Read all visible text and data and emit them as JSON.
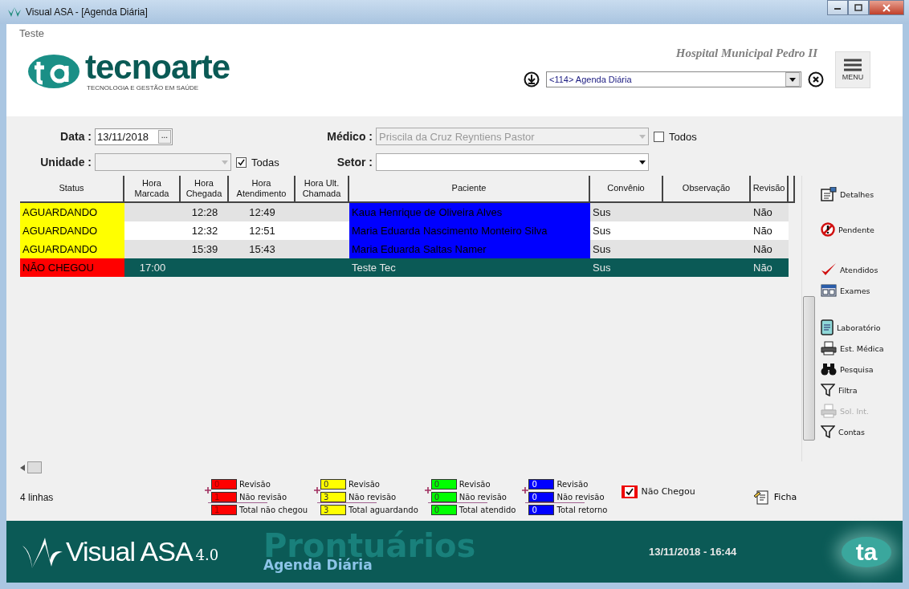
{
  "window": {
    "title": "Visual ASA - [Agenda Diária]"
  },
  "header": {
    "user": "Teste",
    "logo_name": "tecnoarte",
    "logo_tagline": "TECNOLOGIA E GESTÃO EM SAÚDE",
    "hospital": "Hospital Municipal Pedro II",
    "module_select": "<114> Agenda Diária",
    "menu_label": "MENU"
  },
  "filters": {
    "data_label": "Data :",
    "data_value": "13/11/2018",
    "data_button": "...",
    "medico_label": "Médico :",
    "medico_value": "Priscila da Cruz Reyntiens Pastor",
    "todos_label": "Todos",
    "todos_checked": false,
    "unidade_label": "Unidade :",
    "todas_label": "Todas",
    "todas_checked": true,
    "setor_label": "Setor :"
  },
  "table": {
    "columns": [
      "Status",
      "Hora Marcada",
      "Hora Chegada",
      "Hora Atendimento",
      "Hora Ult. Chamada",
      "Paciente",
      "Convênio",
      "Observação",
      "Revisão"
    ],
    "rows": [
      {
        "status": {
          "text": "AGUARDANDO",
          "color": "#ffff00"
        },
        "hora_marcada": "",
        "hora_chegada": "12:28",
        "hora_atendimento": "12:49",
        "paciente": {
          "text": "Kaua Henrique de Oliveira Alves",
          "color": "#0000ff"
        },
        "convenio": "Sus",
        "revisao": "Não",
        "selected": false
      },
      {
        "status": {
          "text": "AGUARDANDO",
          "color": "#ffff00"
        },
        "hora_marcada": "",
        "hora_chegada": "12:32",
        "hora_atendimento": "12:51",
        "paciente": {
          "text": "Maria Eduarda Nascimento Monteiro Silva",
          "color": "#0000ff"
        },
        "convenio": "Sus",
        "revisao": "Não",
        "selected": false
      },
      {
        "status": {
          "text": "AGUARDANDO",
          "color": "#ffff00"
        },
        "hora_marcada": "",
        "hora_chegada": "15:39",
        "hora_atendimento": "15:43",
        "paciente": {
          "text": "Maria Eduarda Saltas Namer",
          "color": "#0000ff"
        },
        "convenio": "Sus",
        "revisao": "Não",
        "selected": false
      },
      {
        "status": {
          "text": "NÃO CHEGOU",
          "color": "#ff0000"
        },
        "hora_marcada": "17:00",
        "hora_chegada": "",
        "hora_atendimento": "",
        "paciente": {
          "text": "Teste Tec"
        },
        "convenio": "Sus",
        "revisao": "Não",
        "selected": true
      }
    ]
  },
  "side_buttons": [
    {
      "label": "Detalhes",
      "kind": "document",
      "disabled": false
    },
    {
      "label": "Pendente",
      "kind": "forbidden",
      "disabled": false
    },
    {
      "label": "Atendidos",
      "kind": "check",
      "disabled": false
    },
    {
      "label": "Exames",
      "kind": "window",
      "disabled": false
    },
    {
      "label": "Laboratório",
      "kind": "notepad",
      "disabled": false
    },
    {
      "label": "Est. Médica",
      "kind": "printer",
      "disabled": false
    },
    {
      "label": "Pesquisa",
      "kind": "binoculars",
      "disabled": false
    },
    {
      "label": "Filtra",
      "kind": "funnel",
      "disabled": false
    },
    {
      "label": "Sol. Int.",
      "kind": "printer",
      "disabled": true
    },
    {
      "label": "Contas",
      "kind": "funnel",
      "disabled": false
    }
  ],
  "summary": {
    "row_count": "4 linhas",
    "groups": [
      {
        "color": "#ff0000",
        "revisao": "0",
        "revisao_label": "Revisão",
        "nao_revisao": "1",
        "nao_revisao_label": "Não revisão",
        "total": "1",
        "total_label": "Total não chegou"
      },
      {
        "color": "#ffff00",
        "revisao": "0",
        "revisao_label": "Revisão",
        "nao_revisao": "3",
        "nao_revisao_label": "Não revisão",
        "total": "3",
        "total_label": "Total aguardando"
      },
      {
        "color": "#00ff00",
        "revisao": "0",
        "revisao_label": "Revisão",
        "nao_revisao": "0",
        "nao_revisao_label": "Não revisão",
        "total": "0",
        "total_label": "Total atendido"
      },
      {
        "color": "#0000ff",
        "revisao": "0",
        "revisao_label": "Revisão",
        "nao_revisao": "0",
        "nao_revisao_label": "Não revisão",
        "total": "0",
        "total_label": "Total retorno"
      }
    ],
    "nao_chegou_label": "Não Chegou",
    "nao_chegou_checked": true,
    "ficha_label": "Ficha"
  },
  "footer": {
    "product": "Visual ASA",
    "version": "4.0",
    "module": "Prontuários",
    "screen": "Agenda Diária",
    "datetime": "13/11/2018 - 16:44",
    "logo": "ta"
  }
}
